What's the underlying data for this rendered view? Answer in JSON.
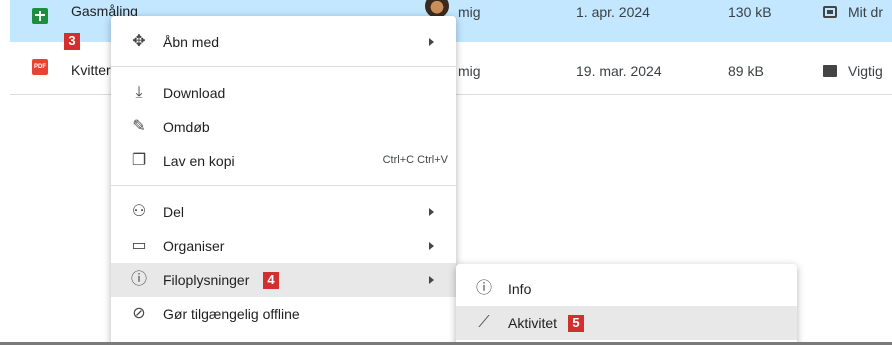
{
  "files": [
    {
      "name": "Gasmåling",
      "type": "sheets",
      "owner": "mig",
      "modified": "1. apr. 2024",
      "size": "130 kB",
      "location": "Mit dr"
    },
    {
      "name": "Kvitter",
      "type": "pdf",
      "type_label": "PDF",
      "owner": "mig",
      "modified": "19. mar. 2024",
      "size": "89 kB",
      "location": "Vigtig"
    }
  ],
  "annotations": {
    "step3": "3",
    "step4": "4",
    "step5": "5"
  },
  "context_menu": {
    "open_with": "Åbn med",
    "download": "Download",
    "rename": "Omdøb",
    "copy": "Lav en kopi",
    "copy_shortcut": "Ctrl+C Ctrl+V",
    "share": "Del",
    "organize": "Organiser",
    "file_info": "Filoplysninger",
    "offline": "Gør tilgængelig offline"
  },
  "submenu": {
    "info": "Info",
    "activity": "Aktivitet"
  },
  "colors": {
    "selected_row": "#c2e7ff",
    "hover": "#e8e8e8",
    "badge": "#d32f2f"
  }
}
